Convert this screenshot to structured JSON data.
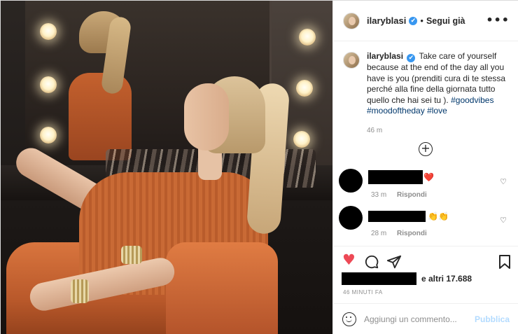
{
  "post": {
    "username": "ilaryblasi",
    "verified_mark": "✔",
    "separator": "•",
    "follow_label": "Segui già",
    "more_label": "•••"
  },
  "caption": {
    "username": "ilaryblasi",
    "text": "Take care of yourself because at the end of the day all you have is you (prenditi cura di te stessa perché alla fine della giornata tutto quello che hai sei tu ).",
    "hashtags": [
      "#goodvibes",
      "#moodoftheday",
      "#love"
    ],
    "time": "46 m"
  },
  "load_more_icon": "+",
  "comments": [
    {
      "emoji": "❤️",
      "time": "33 m",
      "reply_label": "Rispondi",
      "like_icon": "♡"
    },
    {
      "emoji": "👏👏",
      "time": "28 m",
      "reply_label": "Rispondi",
      "like_icon": "♡"
    }
  ],
  "actions": {
    "like_icon": "♥",
    "comment_icon": "comment-bubble",
    "share_icon": "paper-plane",
    "save_icon": "bookmark"
  },
  "likes": {
    "text": "e altri 17.688"
  },
  "timestamp": "46 MINUTI FA",
  "add_comment": {
    "placeholder": "Aggiungi un commento...",
    "publish_label": "Pubblica"
  },
  "colors": {
    "like_red": "#ed4956",
    "hashtag_blue": "#00376b",
    "verified_blue": "#3897f0",
    "publish_disabled": "#b3dbff"
  }
}
